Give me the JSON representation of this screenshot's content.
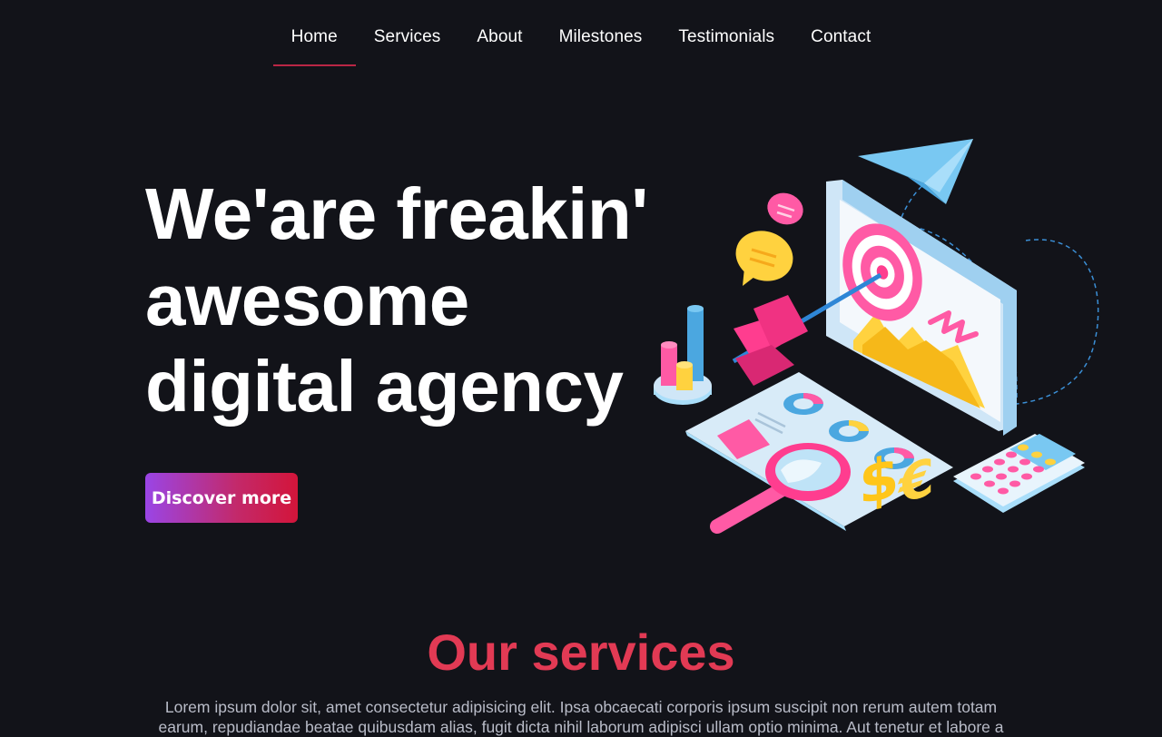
{
  "nav": {
    "items": [
      {
        "label": "Home",
        "active": true
      },
      {
        "label": "Services"
      },
      {
        "label": "About"
      },
      {
        "label": "Milestones"
      },
      {
        "label": "Testimonials"
      },
      {
        "label": "Contact"
      }
    ]
  },
  "hero": {
    "title_lines": [
      "We'are freakin'",
      "awesome",
      "digital agency"
    ],
    "cta_label": "Discover more",
    "illustration_icons": [
      "monitor-icon",
      "target-icon",
      "paper-plane-icon",
      "chat-bubble-icon",
      "bar-chart-icon",
      "magnifier-icon",
      "calculator-icon",
      "dollar-icon",
      "euro-icon",
      "arrow-icon"
    ]
  },
  "services": {
    "title": "Our services",
    "description": "Lorem ipsum dolor sit, amet consectetur adipisicing elit. Ipsa obcaecati corporis ipsum suscipit non rerum autem totam earum, repudiandae beatae quibusdam alias, fugit dicta nihil laborum adipisci ullam optio minima. Aut tenetur et labore a"
  },
  "colors": {
    "background": "#121319",
    "accent": "#e23a54",
    "cta_gradient_start": "#9a45e6",
    "cta_gradient_end": "#d3153a"
  }
}
